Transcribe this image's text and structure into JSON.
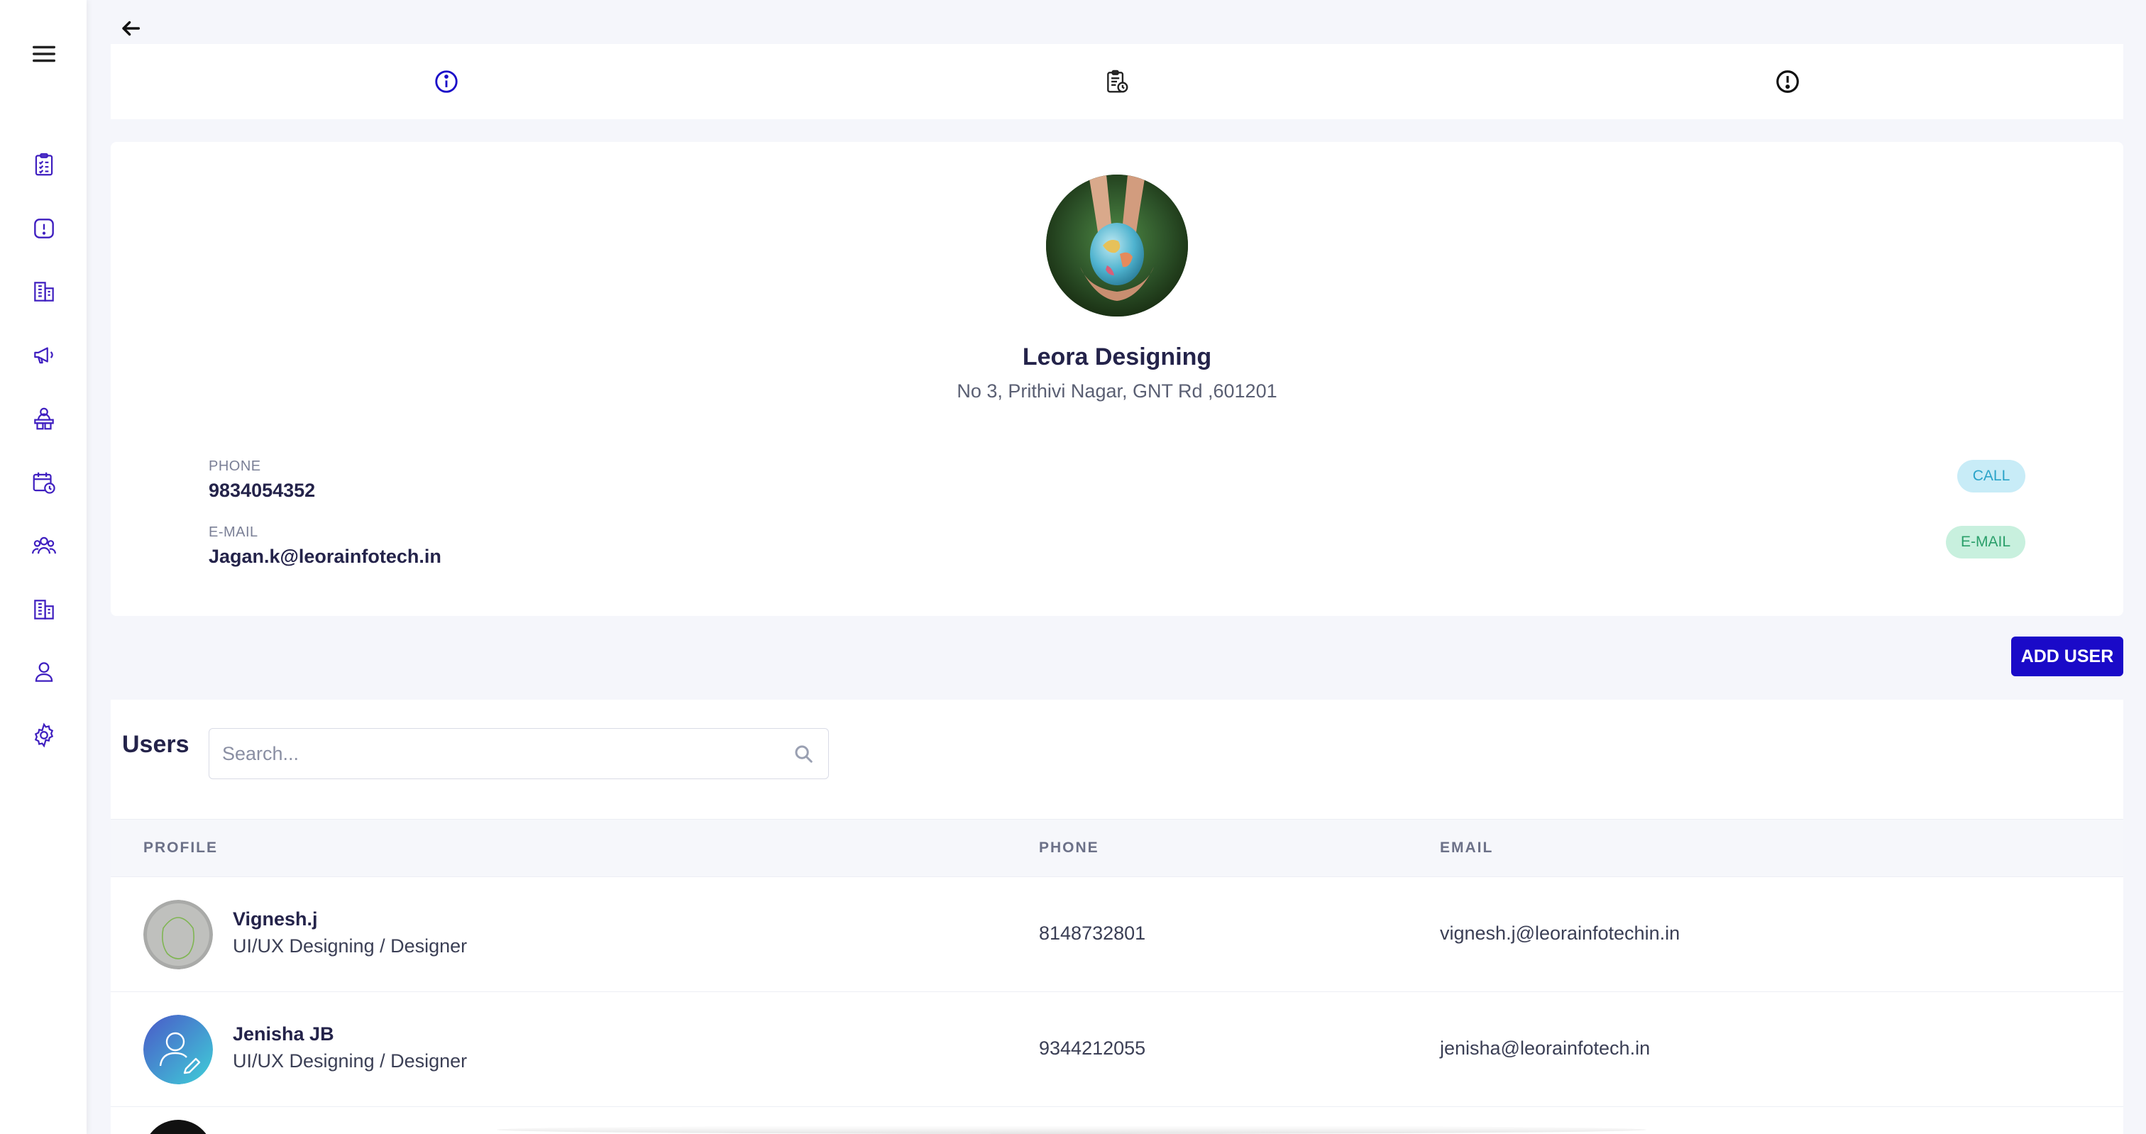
{
  "nav": {
    "items": [
      {
        "icon": "menu-icon"
      },
      {
        "icon": "checklist-icon"
      },
      {
        "icon": "alert-square-icon"
      },
      {
        "icon": "building-icon"
      },
      {
        "icon": "megaphone-icon"
      },
      {
        "icon": "user-desk-icon"
      },
      {
        "icon": "calendar-clock-icon"
      },
      {
        "icon": "team-icon"
      },
      {
        "icon": "office-building-icon"
      },
      {
        "icon": "user-icon"
      },
      {
        "icon": "settings-icon"
      }
    ]
  },
  "tabs": [
    {
      "icon": "info-circle-icon",
      "active": true
    },
    {
      "icon": "report-clock-icon",
      "active": false
    },
    {
      "icon": "alert-circle-icon",
      "active": false
    }
  ],
  "org": {
    "name": "Leora Designing",
    "address": "No 3, Prithivi Nagar, GNT Rd ,601201",
    "phone_label": "PHONE",
    "phone": "9834054352",
    "email_label": "E-MAIL",
    "email": "Jagan.k@leorainfotech.in",
    "call_button": "CALL",
    "email_button": "E-MAIL"
  },
  "actions": {
    "add_user": "ADD USER"
  },
  "users": {
    "title": "Users",
    "search_placeholder": "Search...",
    "columns": [
      "PROFILE",
      "PHONE",
      "EMAIL"
    ],
    "rows": [
      {
        "name": "Vignesh.j",
        "role": "UI/UX Designing  / Designer",
        "phone": "8148732801",
        "email": "vignesh.j@leorainfotechin.in"
      },
      {
        "name": "Jenisha JB",
        "role": "UI/UX Designing  / Designer",
        "phone": "9344212055",
        "email": "jenisha@leorainfotech.in"
      }
    ]
  },
  "colors": {
    "accent": "#3f1fc0",
    "primary_button": "#1a0ac8",
    "call_pill_bg": "#c8ecf7",
    "email_pill_bg": "#c8f0de"
  }
}
